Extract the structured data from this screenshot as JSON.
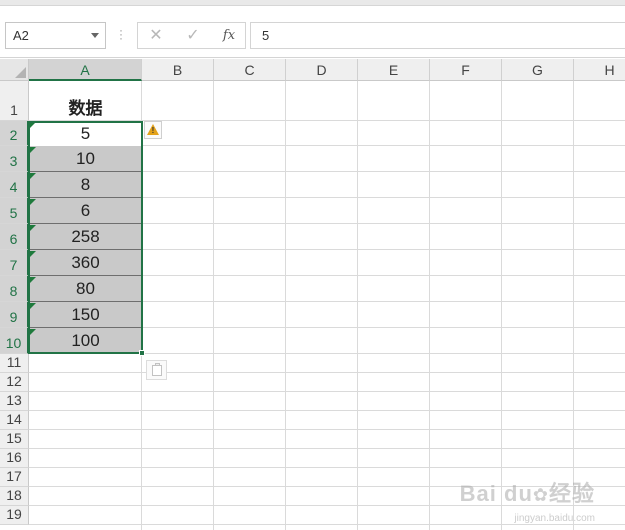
{
  "formula_bar": {
    "name_box": "A2",
    "cancel_icon": "✕",
    "enter_icon": "✓",
    "fx_label": "fx",
    "formula_value": "5"
  },
  "columns": [
    "A",
    "B",
    "C",
    "D",
    "E",
    "F",
    "G",
    "H"
  ],
  "rows": [
    "1",
    "2",
    "3",
    "4",
    "5",
    "6",
    "7",
    "8",
    "9",
    "10",
    "11",
    "12",
    "13",
    "14",
    "15",
    "16",
    "17",
    "18",
    "19"
  ],
  "column_a": {
    "header": "数据",
    "values": [
      "5",
      "10",
      "8",
      "6",
      "258",
      "360",
      "80",
      "150",
      "100"
    ]
  },
  "icons": {
    "warning": "warning-triangle-icon",
    "paste_options": "paste-options-icon"
  },
  "colors": {
    "selection": "#217346",
    "cell_shade": "#c9c9c9",
    "error_flag": "#1e7a3c"
  },
  "watermark": {
    "brand": "Bai du",
    "suffix": "经验",
    "sub": "jingyan.baidu.com"
  }
}
